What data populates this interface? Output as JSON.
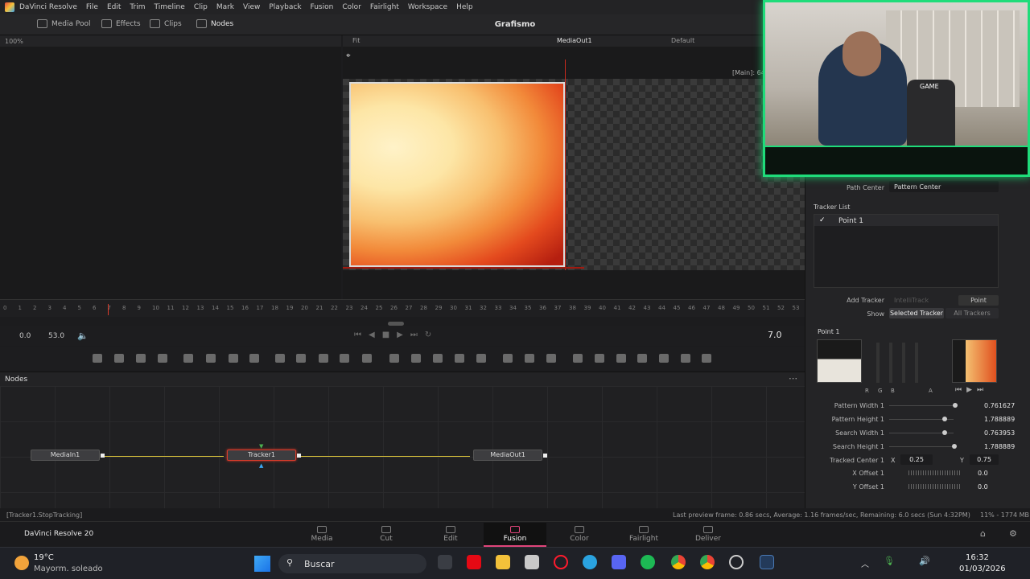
{
  "menubar": {
    "app": "DaVinci Resolve",
    "items": [
      "File",
      "Edit",
      "Trim",
      "Timeline",
      "Clip",
      "Mark",
      "View",
      "Playback",
      "Fusion",
      "Color",
      "Fairlight",
      "Workspace",
      "Help"
    ]
  },
  "toolbar": {
    "media_pool": "Media Pool",
    "effects": "Effects",
    "clips": "Clips",
    "nodes": "Nodes",
    "project_title": "Grafismo"
  },
  "viewer_left": {
    "zoom": "100%"
  },
  "viewer_right": {
    "fit": "Fit",
    "title": "MediaOut1",
    "lut": "Default",
    "overlay": "[Main]: 64"
  },
  "ruler": {
    "ticks": [
      "0",
      "1",
      "2",
      "3",
      "4",
      "5",
      "6",
      "7",
      "8",
      "9",
      "10",
      "11",
      "12",
      "13",
      "14",
      "15",
      "16",
      "17",
      "18",
      "19",
      "20",
      "21",
      "22",
      "23",
      "24",
      "25",
      "26",
      "27",
      "28",
      "29",
      "30",
      "31",
      "32",
      "33",
      "34",
      "35",
      "36",
      "37",
      "38",
      "39",
      "40",
      "41",
      "42",
      "43",
      "44",
      "45",
      "46",
      "47",
      "48",
      "49",
      "50",
      "51",
      "52",
      "53"
    ]
  },
  "transport": {
    "start": "0.0",
    "end": "53.0",
    "current": "7.0"
  },
  "nodes_panel": {
    "title": "Nodes",
    "nodes": [
      "MediaIn1",
      "Tracker1",
      "MediaOut1"
    ]
  },
  "inspector": {
    "path_center_label": "Path Center",
    "path_center_value": "Pattern Center",
    "tracker_list_label": "Tracker List",
    "tracker_item": "Point 1",
    "add_tracker_label": "Add Tracker",
    "intellitrack": "IntelliTrack",
    "point_btn": "Point",
    "show_label": "Show",
    "selected_tracker": "Selected Tracker",
    "all_trackers": "All Trackers",
    "point_title": "Point 1",
    "params": [
      {
        "label": "Pattern Width 1",
        "value": "0.761627"
      },
      {
        "label": "Pattern Height 1",
        "value": "1.788889"
      },
      {
        "label": "Search Width 1",
        "value": "0.763953"
      },
      {
        "label": "Search Height 1",
        "value": "1.788889"
      }
    ],
    "tracked_center_label": "Tracked Center 1",
    "x_label": "X",
    "x_value": "0.25",
    "y_label": "Y",
    "y_value": "0.75",
    "x_offset_label": "X Offset 1",
    "x_offset_value": "0.0",
    "y_offset_label": "Y Offset 1",
    "y_offset_value": "0.0",
    "channel_buttons": [
      "R",
      "G",
      "B",
      "A"
    ]
  },
  "status": {
    "left": "[Tracker1.StopTracking]",
    "center": "Last preview frame: 0.86 secs, Average: 1.16 frames/sec, Remaining: 6.0 secs (Sun 4:32PM)",
    "right": "11% - 1774 MB"
  },
  "pagebar": {
    "brand": "DaVinci Resolve 20",
    "pages": [
      "Media",
      "Cut",
      "Edit",
      "Fusion",
      "Color",
      "Fairlight",
      "Deliver"
    ],
    "active": "Fusion"
  },
  "webcam": {
    "label": "GAME"
  },
  "taskbar": {
    "temp": "19°C",
    "weather": "Mayorm. soleado",
    "search": "Buscar",
    "time": "16:32",
    "date": "01/03/2026"
  },
  "colors": {
    "accent": "#e0457b",
    "wire": "#d8c23a",
    "webcam_border": "#1fdc7a",
    "tracker_red": "#d93b2b"
  }
}
